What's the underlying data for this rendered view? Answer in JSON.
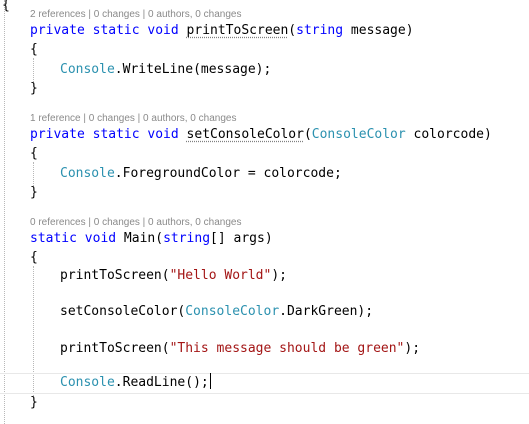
{
  "editor": {
    "outer_brace": "{",
    "codelens": [
      "2 references | 0 changes | 0 authors, 0 changes",
      "1 reference | 0 changes | 0 authors, 0 changes",
      "0 references | 0 changes | 0 authors, 0 changes"
    ],
    "methods": {
      "print": {
        "sig_kw": "private static void ",
        "name": "printToScreen",
        "open_paren": "(",
        "param_type": "string",
        "param": " message)",
        "open_brace": "{",
        "body_type": "Console",
        "body_rest": ".WriteLine(message);",
        "close_brace": "}"
      },
      "color": {
        "sig_kw": "private static void ",
        "name": "setConsoleColor",
        "open_paren": "(",
        "param_type": "ConsoleColor",
        "param": " colorcode)",
        "open_brace": "{",
        "body_type": "Console",
        "body_rest": ".ForegroundColor = colorcode;",
        "close_brace": "}"
      },
      "main": {
        "kw_static": "static",
        "sp": " ",
        "kw_void": "void",
        "name": " Main(",
        "param_type": "string",
        "param": "[] args)",
        "open_brace": "{",
        "line1_call": "printToScreen(",
        "line1_str": "\"Hello World\"",
        "line1_end": ");",
        "line2_call": "setConsoleColor(",
        "line2_type": "ConsoleColor",
        "line2_end": ".DarkGreen);",
        "line3_call": "printToScreen(",
        "line3_str": "\"This message should be green\"",
        "line3_end": ");",
        "line4_type": "Console",
        "line4_end": ".ReadLine();",
        "close_brace": "}"
      }
    }
  },
  "colors": {
    "keyword": "#0000ff",
    "type": "#2b91af",
    "string": "#a31515",
    "codelens": "#8a8a8a"
  }
}
